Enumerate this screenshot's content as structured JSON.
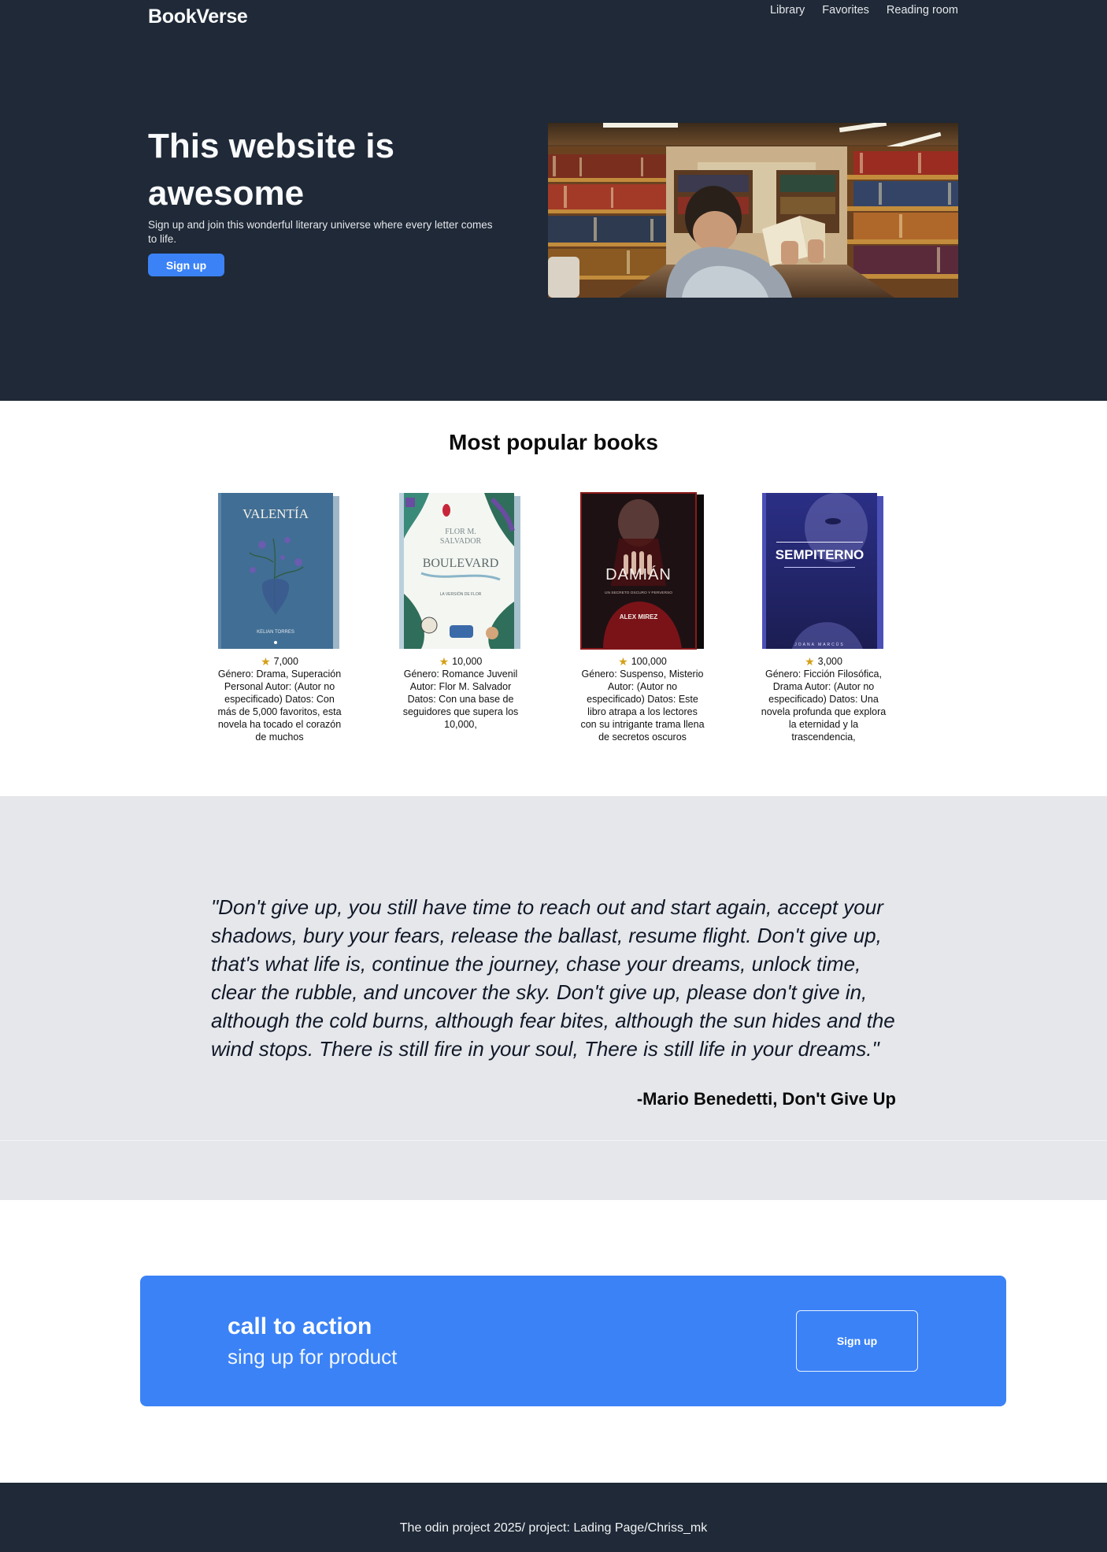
{
  "header": {
    "logo": "BookVerse",
    "nav": [
      "Library",
      "Favorites",
      "Reading room"
    ]
  },
  "hero": {
    "title": "This website is awesome",
    "subtitle": "Sign up and join this wonderful literary universe where every letter comes to life.",
    "button": "Sign up",
    "image_description": "man-reading-in-library"
  },
  "books": {
    "title": "Most popular books",
    "items": [
      {
        "cover_title": "VALENTÍA",
        "cover_author": "KELIAN TORRES",
        "rating_icon": "star-icon",
        "count": "7,000",
        "description": "Género: Drama, Superación Personal Autor: (Autor no especificado) Datos: Con más de 5,000 favoritos, esta novela ha tocado el corazón de muchos"
      },
      {
        "cover_title": "BOULEVARD",
        "cover_author": "FLOR M. SALVADOR",
        "cover_small": "LA VERSIÓN DE FLOR",
        "rating_icon": "star-icon",
        "count": "10,000",
        "description": "Género: Romance Juvenil Autor: Flor M. Salvador Datos: Con una base de seguidores que supera los 10,000,"
      },
      {
        "cover_title": "DAMIÁN",
        "cover_author": "ALEX MIREZ",
        "cover_small": "UN SECRETO OSCURO Y PERVERSO",
        "rating_icon": "star-icon",
        "count": "100,000",
        "description": "Género: Suspenso, Misterio Autor: (Autor no especificado) Datos: Este libro atrapa a los lectores con su intrigante trama llena de secretos oscuros"
      },
      {
        "cover_title": "SEMPITERNO",
        "cover_author": "JOANA MARCÚS",
        "rating_icon": "star-icon",
        "count": "3,000",
        "description": "Género: Ficción Filosófica, Drama Autor: (Autor no especificado) Datos: Una novela profunda que explora la eternidad y la trascendencia,"
      }
    ]
  },
  "quote": {
    "text": "\"Don't give up, you still have time to reach out and start again, accept your shadows, bury your fears, release the ballast, resume flight. Don't give up, that's what life is, continue the journey, chase your dreams, unlock time, clear the rubble, and uncover the sky. Don't give up, please don't give in, although the cold burns, although fear bites, although the sun hides and the wind stops. There is still fire in your soul, There is still life in your dreams.\"",
    "author": "-Mario Benedetti, Don't Give Up"
  },
  "cta": {
    "title": "call to action",
    "subtitle": "sing up for product",
    "button": "Sign up"
  },
  "footer": {
    "text": "The odin project 2025/ project: Lading Page/Chriss_mk"
  },
  "colors": {
    "dark": "#1f2937",
    "accent": "#3b82f6",
    "quote_bg": "#e5e7eb",
    "star": "#d4a017"
  }
}
